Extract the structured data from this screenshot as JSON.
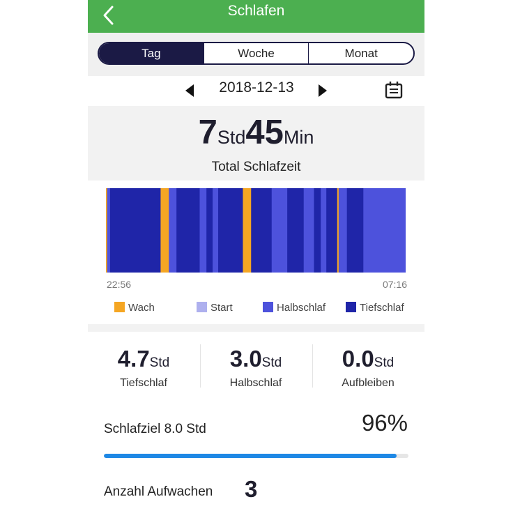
{
  "header": {
    "title": "Schlafen",
    "back_icon": "chevron-left-icon"
  },
  "tabs": [
    {
      "label": "Tag",
      "active": true
    },
    {
      "label": "Woche",
      "active": false
    },
    {
      "label": "Monat",
      "active": false
    }
  ],
  "date_nav": {
    "date": "2018-12-13",
    "prev_icon": "triangle-left-icon",
    "next_icon": "triangle-right-icon",
    "calendar_icon": "calendar-icon"
  },
  "total": {
    "hours": "7",
    "hours_unit": "Std",
    "minutes": "45",
    "minutes_unit": "Min",
    "label": "Total Schlafzeit"
  },
  "chart_data": {
    "type": "timeline",
    "start_time": "22:56",
    "end_time": "07:16",
    "legend": [
      {
        "key": "wach",
        "label": "Wach",
        "color": "#f5a623"
      },
      {
        "key": "start",
        "label": "Start",
        "color": "#aeb0ee"
      },
      {
        "key": "halbschlaf",
        "label": "Halbschlaf",
        "color": "#4d52dc"
      },
      {
        "key": "tiefschlaf",
        "label": "Tiefschlaf",
        "color": "#1f25a8"
      }
    ],
    "segments": [
      {
        "stage": "wach",
        "share": 0.004
      },
      {
        "stage": "halbschlaf",
        "share": 0.01
      },
      {
        "stage": "tiefschlaf",
        "share": 0.172
      },
      {
        "stage": "wach",
        "share": 0.028
      },
      {
        "stage": "halbschlaf",
        "share": 0.026
      },
      {
        "stage": "tiefschlaf",
        "share": 0.079
      },
      {
        "stage": "halbschlaf",
        "share": 0.023
      },
      {
        "stage": "tiefschlaf",
        "share": 0.021
      },
      {
        "stage": "halbschlaf",
        "share": 0.019
      },
      {
        "stage": "tiefschlaf",
        "share": 0.084
      },
      {
        "stage": "wach",
        "share": 0.028
      },
      {
        "stage": "tiefschlaf",
        "share": 0.07
      },
      {
        "stage": "halbschlaf",
        "share": 0.053
      },
      {
        "stage": "tiefschlaf",
        "share": 0.056
      },
      {
        "stage": "halbschlaf",
        "share": 0.035
      },
      {
        "stage": "tiefschlaf",
        "share": 0.023
      },
      {
        "stage": "halbschlaf",
        "share": 0.019
      },
      {
        "stage": "tiefschlaf",
        "share": 0.037
      },
      {
        "stage": "wach",
        "share": 0.005
      },
      {
        "stage": "halbschlaf",
        "share": 0.028
      },
      {
        "stage": "tiefschlaf",
        "share": 0.056
      },
      {
        "stage": "halbschlaf",
        "share": 0.144
      }
    ]
  },
  "stats": [
    {
      "value": "4.7",
      "unit": "Std",
      "label": "Tiefschlaf"
    },
    {
      "value": "3.0",
      "unit": "Std",
      "label": "Halbschlaf"
    },
    {
      "value": "0.0",
      "unit": "Std",
      "label": "Aufbleiben"
    }
  ],
  "goal": {
    "label": "Schlafziel 8.0 Std",
    "percent_text": "96%",
    "progress": 0.96,
    "bar_color": "#1e88e5"
  },
  "wake": {
    "label": "Anzahl Aufwachen",
    "count": "3"
  },
  "colors": {
    "header": "#4caf50",
    "accent_dark": "#1b1a45"
  }
}
